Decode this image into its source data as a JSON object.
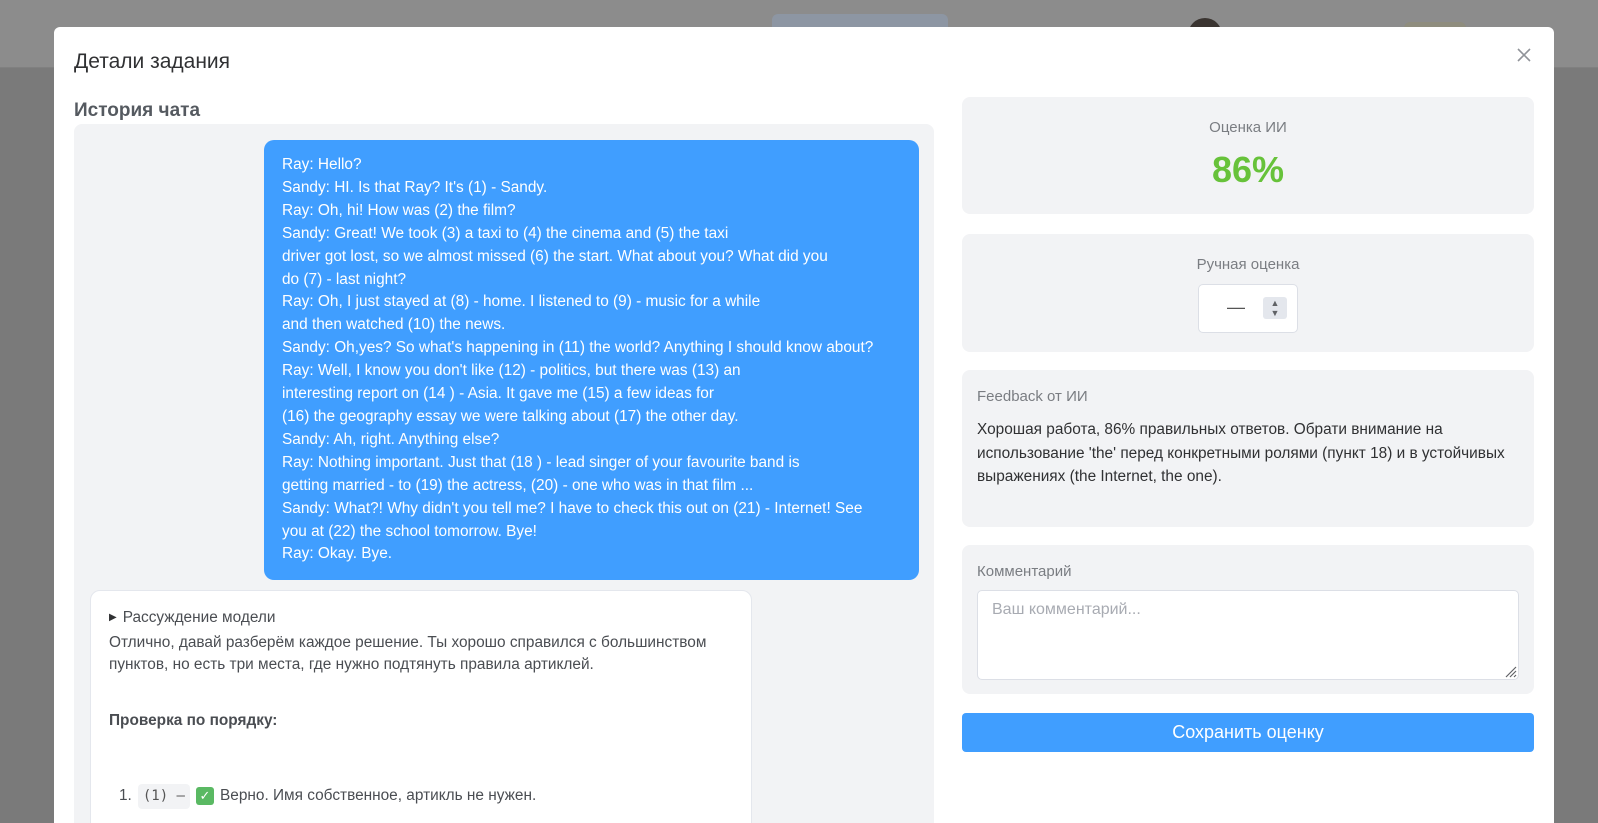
{
  "modal": {
    "title": "Детали задания"
  },
  "chat": {
    "section_title": "История чата",
    "user_message_lines": [
      "Ray: Hello?",
      "Sandy: HI. Is that Ray? It's (1) - Sandy.",
      "Ray: Oh, hi! How was (2) the film?",
      "Sandy: Great! We took (3) a taxi to (4) the cinema and (5) the taxi",
      "driver got lost, so we almost missed (6) the start. What about you? What did you",
      "do (7) - last night?",
      "Ray: Oh, I just stayed at (8) - home. I listened to (9) - music for a while",
      "and then watched (10) the news.",
      "Sandy: Oh,yes? So what's happening in (11) the world? Anything I should know about?",
      "Ray: Well, I know you don't like (12) - politics, but there was (13) an",
      "interesting report on (14 ) - Asia. It gave me (15) a few ideas for",
      "(16) the geography essay we were talking about (17) the other day.",
      "Sandy: Ah, right. Anything else?",
      "Ray: Nothing important. Just that (18 ) - lead singer of your favourite band is",
      "getting married - to (19) the actress, (20) - one who was in that film ...",
      "Sandy: What?! Why didn't you tell me? I have to check this out on (21) - Internet! See",
      "you at (22) the school tomorrow. Bye!",
      "Ray: Okay. Bye."
    ],
    "ai_reply": {
      "reasoning_toggle": "Рассуждение модели",
      "intro_line1": "Отлично, давай разберём каждое решение. Ты хорошо справился с большинством",
      "intro_line2": "пунктов, но есть три места, где нужно подтянуть правила артиклей.",
      "heading": "Проверка по порядку:",
      "item_number": "1.",
      "item_code": "(1) –",
      "item_text": "Верно. Имя собственное, артикль не нужен."
    }
  },
  "sidebar": {
    "ai_score_label": "Оценка ИИ",
    "ai_score_value": "86%",
    "manual_score_label": "Ручная оценка",
    "manual_score_value": "—",
    "feedback_label": "Feedback от ИИ",
    "feedback_text": "Хорошая работа, 86% правильных ответов. Обрати внимание на использование 'the' перед конкретными ролями (пункт 18) и в устойчивых выражениях (the Internet, the one).",
    "comment_label": "Комментарий",
    "comment_placeholder": "Ваш комментарий...",
    "save_button": "Сохранить оценку"
  },
  "colors": {
    "primary": "#409eff",
    "score_green": "#67c23a",
    "card_bg": "#f2f3f5"
  },
  "icons": {
    "close": "close-icon",
    "check": "check-mark-icon",
    "toggle": "triangle-right-icon"
  }
}
